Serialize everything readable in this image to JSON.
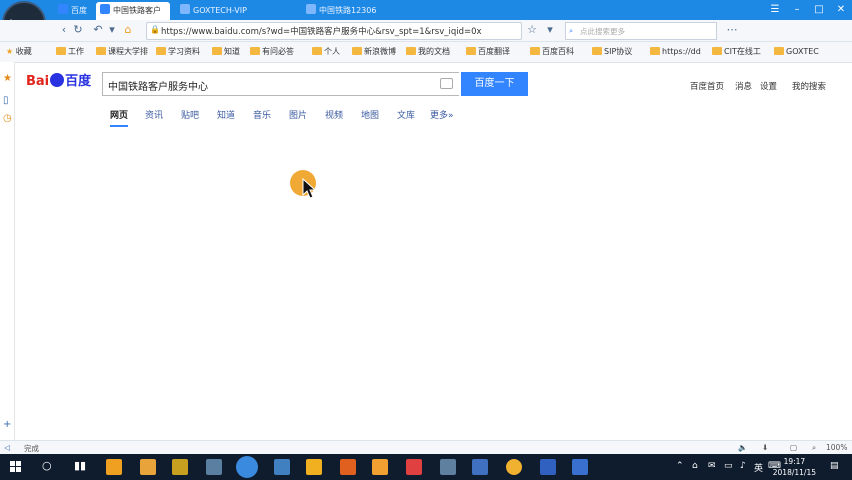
{
  "browser": {
    "tabs": [
      {
        "label": "百度"
      },
      {
        "label": "中国铁路客户"
      },
      {
        "label": "GOXTECH-VIP"
      },
      {
        "label": "中国铁路12306"
      }
    ],
    "url": "https://www.baidu.com/s?wd=中国铁路客户服务中心&rsv_spt=1&rsv_iqid=0x",
    "search_placeholder": "点此搜索更多",
    "avatar_text": "翩"
  },
  "bookmarks": [
    {
      "label": "收藏"
    },
    {
      "label": "工作"
    },
    {
      "label": "课程大学排"
    },
    {
      "label": "学习资料"
    },
    {
      "label": "知道"
    },
    {
      "label": "有问必答"
    },
    {
      "label": "个人"
    },
    {
      "label": "新浪微博"
    },
    {
      "label": "我的文档"
    },
    {
      "label": "百度翻译"
    },
    {
      "label": "百度百科"
    },
    {
      "label": "SIP协议"
    },
    {
      "label": "https://dd"
    },
    {
      "label": "CIT在线工"
    },
    {
      "label": "GOXTEC"
    }
  ],
  "baidu": {
    "logo_left": "Bai",
    "logo_right": "百度",
    "query": "中国铁路客户服务中心",
    "search_button": "百度一下",
    "top_links": [
      "百度首页",
      "消息",
      "设置",
      "我的搜索"
    ],
    "nav_tabs": [
      "网页",
      "资讯",
      "贴吧",
      "知道",
      "音乐",
      "图片",
      "视频",
      "地图",
      "文库",
      "更多»"
    ]
  },
  "statusbar": {
    "left": "完成",
    "zoom": "100%"
  },
  "taskbar": {
    "time": "19:17",
    "date": "2018/11/15",
    "lang": "英"
  }
}
